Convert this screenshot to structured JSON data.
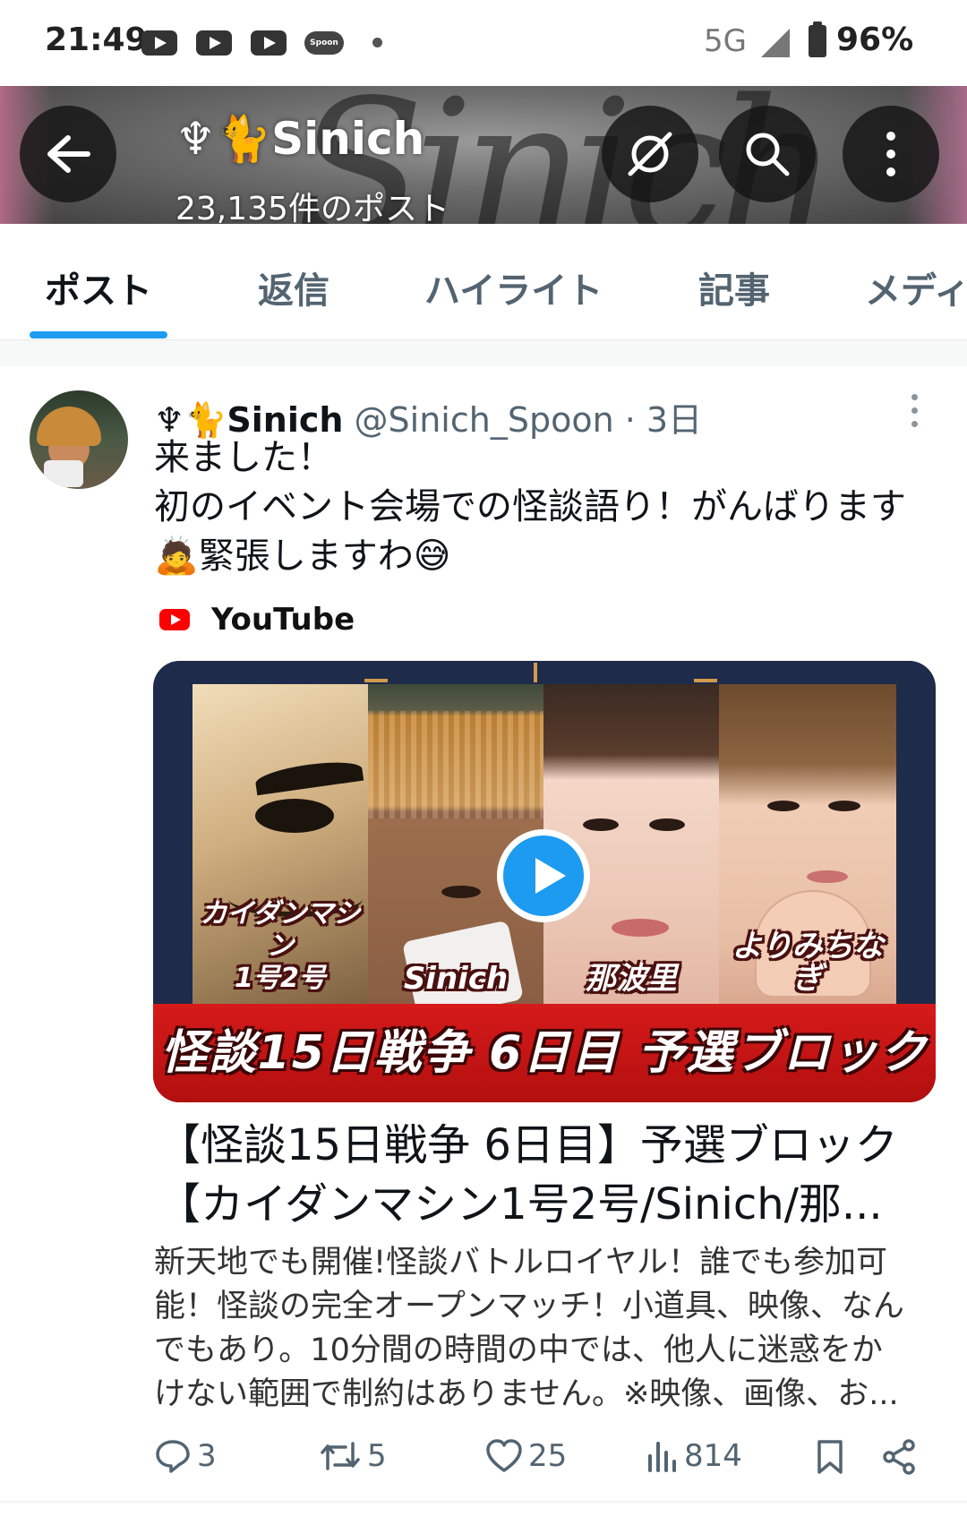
{
  "status_bar": {
    "time": "21:49",
    "notification_icons": [
      "youtube-icon",
      "youtube-icon",
      "youtube-icon",
      "spoon-icon",
      "dot"
    ],
    "spoon_label": "Spoon",
    "network": "5G",
    "battery": "96%"
  },
  "header": {
    "name": "♆🐈Sinich",
    "post_count": "23,135件のポスト",
    "buttons": [
      "back-icon",
      "translate-off-icon",
      "search-icon",
      "more-vertical-icon"
    ]
  },
  "tabs": {
    "items": [
      {
        "label": "ポスト",
        "active": true
      },
      {
        "label": "返信",
        "active": false
      },
      {
        "label": "ハイライト",
        "active": false
      },
      {
        "label": "記事",
        "active": false
      },
      {
        "label": "メディア",
        "active": false
      }
    ],
    "accent": "#1d9bf0"
  },
  "post": {
    "display_name": "♆🐈Sinich",
    "handle": "@Sinich_Spoon",
    "time": "· 3日",
    "lines": [
      "来ました！",
      "初のイベント会場での怪談語り！がんばります",
      "🙇緊張しますわ😅"
    ],
    "source": "YouTube",
    "card": {
      "panels": [
        "カイダンマシン\n1号2号",
        "Sinich",
        "那波里",
        "よりみちなぎ"
      ],
      "banner": "怪談15日戦争 6日目 予選ブロック",
      "title_lines": [
        "【怪談15日戦争 6日目】予選ブロック",
        "【カイダンマシン1号2号/Sinich/那..."
      ],
      "description_lines": [
        "新天地でも開催!怪談バトルロイヤル！誰でも参加可",
        "能！怪談の完全オープンマッチ！小道具、映像、なん",
        "でもあり。10分間の時間の中では、他人に迷惑をか",
        "けない範囲で制約はありません。※映像、画像、お..."
      ]
    },
    "stats": {
      "replies": "3",
      "reposts": "5",
      "likes": "25",
      "views": "814"
    }
  }
}
